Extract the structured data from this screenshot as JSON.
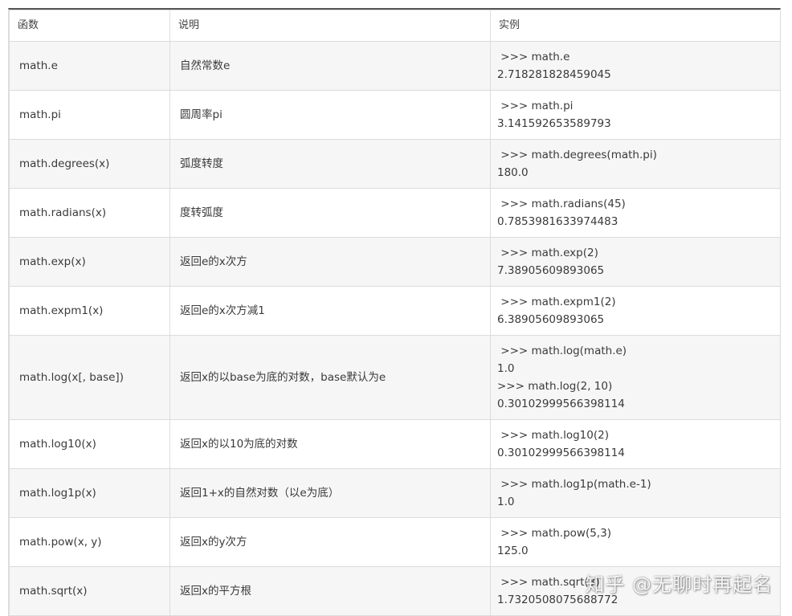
{
  "headers": {
    "func": "函数",
    "desc": "说明",
    "example": "实例"
  },
  "rows": [
    {
      "func": "math.e",
      "desc": "自然常数e",
      "example": [
        " >>> math.e",
        "2.718281828459045"
      ]
    },
    {
      "func": "math.pi",
      "desc": "圆周率pi",
      "example": [
        " >>> math.pi",
        "3.141592653589793"
      ]
    },
    {
      "func": "math.degrees(x)",
      "desc": "弧度转度",
      "example": [
        " >>> math.degrees(math.pi)",
        "180.0"
      ]
    },
    {
      "func": "math.radians(x)",
      "desc": "度转弧度",
      "example": [
        " >>> math.radians(45)",
        "0.7853981633974483"
      ]
    },
    {
      "func": "math.exp(x)",
      "desc": "返回e的x次方",
      "example": [
        " >>> math.exp(2)",
        "7.38905609893065"
      ]
    },
    {
      "func": "math.expm1(x)",
      "desc": "返回e的x次方减1",
      "example": [
        " >>> math.expm1(2)",
        "6.38905609893065"
      ]
    },
    {
      "func": "math.log(x[, base])",
      "desc": "返回x的以base为底的对数，base默认为e",
      "example": [
        " >>> math.log(math.e)",
        "1.0",
        ">>> math.log(2, 10)",
        "0.30102999566398114"
      ]
    },
    {
      "func": "math.log10(x)",
      "desc": "返回x的以10为底的对数",
      "example": [
        " >>> math.log10(2)",
        "0.30102999566398114"
      ]
    },
    {
      "func": "math.log1p(x)",
      "desc": "返回1+x的自然对数（以e为底）",
      "example": [
        " >>> math.log1p(math.e-1)",
        "1.0"
      ]
    },
    {
      "func": "math.pow(x, y)",
      "desc": "返回x的y次方",
      "example": [
        " >>> math.pow(5,3)",
        "125.0"
      ]
    },
    {
      "func": "math.sqrt(x)",
      "desc": "返回x的平方根",
      "example": [
        " >>> math.sqrt(3)",
        "1.7320508075688772"
      ]
    }
  ],
  "watermark": "知乎 @无聊时再起名"
}
